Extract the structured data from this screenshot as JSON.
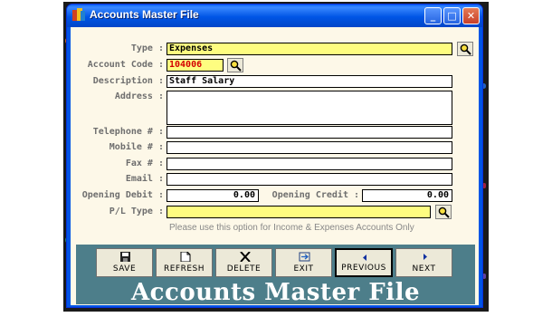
{
  "window": {
    "title": "Accounts Master File",
    "minimize_glyph": "_",
    "maximize_glyph": "□",
    "close_glyph": "✕"
  },
  "form": {
    "type": {
      "label": "Type :",
      "value": "Expenses"
    },
    "account_code": {
      "label": "Account Code :",
      "value": "104006"
    },
    "description": {
      "label": "Description :",
      "value": "Staff Salary"
    },
    "address": {
      "label": "Address :",
      "value": ""
    },
    "telephone": {
      "label": "Telephone # :",
      "value": ""
    },
    "mobile": {
      "label": "Mobile # :",
      "value": ""
    },
    "fax": {
      "label": "Fax # :",
      "value": ""
    },
    "email": {
      "label": "Email :",
      "value": ""
    },
    "opening_debit": {
      "label": "Opening Debit :",
      "value": "0.00"
    },
    "opening_credit": {
      "label": "Opening Credit :",
      "value": "0.00"
    },
    "pl_type": {
      "label": "P/L Type :",
      "value": ""
    },
    "pl_hint": "Please use this option for Income & Expenses Accounts Only"
  },
  "toolbar": {
    "save": "SAVE",
    "refresh": "REFRESH",
    "delete": "DELETE",
    "exit": "EXIT",
    "previous": "PREVIOUS",
    "next": "NEXT"
  },
  "banner": "Accounts Master File",
  "colors": {
    "field_yellow": "#fefd80",
    "account_code_text": "#d40000",
    "panel": "#4d7e8a",
    "client_bg": "#fdf8e8"
  }
}
